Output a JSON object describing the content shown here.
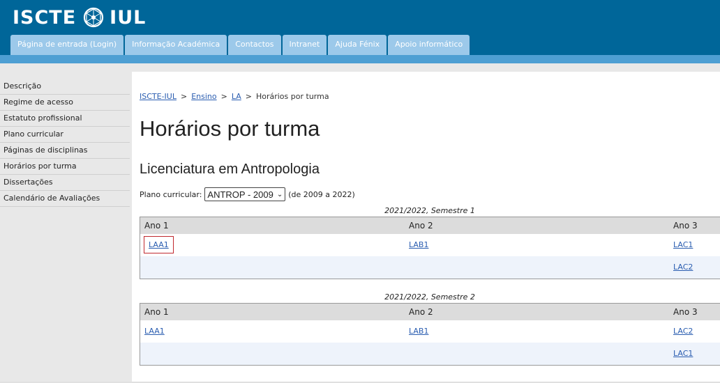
{
  "header": {
    "logo_left": "ISCTE",
    "logo_right": "IUL",
    "tabs": [
      {
        "label": "Página de entrada (Login)"
      },
      {
        "label": "Informação Académica"
      },
      {
        "label": "Contactos"
      },
      {
        "label": "Intranet"
      },
      {
        "label": "Ajuda Fénix"
      },
      {
        "label": "Apoio informático"
      }
    ]
  },
  "sidebar": {
    "items": [
      {
        "label": "Descrição"
      },
      {
        "label": "Regime de acesso"
      },
      {
        "label": "Estatuto profissional"
      },
      {
        "label": "Plano curricular"
      },
      {
        "label": "Páginas de disciplinas"
      },
      {
        "label": "Horários por turma"
      },
      {
        "label": "Dissertações"
      },
      {
        "label": "Calendário de Avaliações"
      }
    ]
  },
  "breadcrumb": {
    "items": [
      "ISCTE-IUL",
      "Ensino",
      "LA"
    ],
    "current": "Horários por turma",
    "separator": ">"
  },
  "page_title": "Horários por turma",
  "course_title": "Licenciatura em Antropologia",
  "plan": {
    "label": "Plano curricular:",
    "selected": "ANTROP - 2009",
    "range": "(de 2009 a 2022)"
  },
  "semesters": [
    {
      "label": "2021/2022, Semestre 1",
      "headers": [
        "Ano 1",
        "Ano 2",
        "Ano 3"
      ],
      "rows": [
        [
          "LAA1",
          "LAB1",
          "LAC1"
        ],
        [
          "",
          "",
          "LAC2"
        ]
      ]
    },
    {
      "label": "2021/2022, Semestre 2",
      "headers": [
        "Ano 1",
        "Ano 2",
        "Ano 3"
      ],
      "rows": [
        [
          "LAA1",
          "LAB1",
          "LAC2"
        ],
        [
          "",
          "",
          "LAC1"
        ]
      ]
    }
  ],
  "colors": {
    "header_bg": "#006699",
    "tab_bg": "#9cc9ea",
    "link": "#2a5db0",
    "highlight": "#c0272d"
  }
}
